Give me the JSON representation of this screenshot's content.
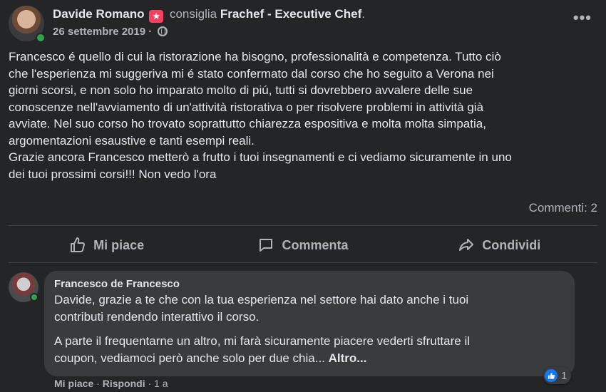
{
  "post": {
    "author": "Davide Romano",
    "verb": "consiglia",
    "page": "Frachef - Executive Chef",
    "period": ".",
    "date": "26 settembre 2019",
    "date_sep": " · ",
    "more_glyph": "•••",
    "body": "Francesco é quello di cui la ristorazione ha bisogno, professionalità e competenza. Tutto ciò\nche l'esperienza mi suggeriva mi é stato confermato dal corso che ho seguito a Verona nei\ngiorni scorsi, e non solo ho imparato molto di piú, tutti si dovrebbero avvalere delle sue\nconoscenze nell'avviamento di un'attività ristorativa o per risolvere problemi in attività già\navviate. Nel suo corso ho trovato soprattutto chiarezza espositiva e molta molta simpatia,\nargomentazioni esaustive e tanti esempi reali.\nGrazie ancora Francesco metterò a frutto i tuoi insegnamenti e ci vediamo sicuramente in uno\ndei tuoi prossimi corsi!!! Non vedo l'ora",
    "comments_count": "Commenti: 2"
  },
  "actions": {
    "like": "Mi piace",
    "comment": "Commenta",
    "share": "Condividi"
  },
  "comment": {
    "author": "Francesco de Francesco",
    "text1": "Davide, grazie a te che con la tua esperienza nel settore hai dato anche i tuoi\ncontributi rendendo interattivo il corso.",
    "text2": "A parte il frequentarne un altro, mi farà sicuramente piacere vederti sfruttare il\ncoupon, vediamoci però anche solo per due chia... ",
    "more": "Altro...",
    "reaction_count": "1",
    "footer_like": "Mi piace",
    "footer_sep1": " · ",
    "footer_reply": "Rispondi",
    "footer_sep2": " · ",
    "footer_time": "1 a"
  },
  "colors": {
    "background": "#242526",
    "bubble": "#3a3b3c",
    "online": "#31a24c",
    "like_blue": "#1877f2"
  }
}
